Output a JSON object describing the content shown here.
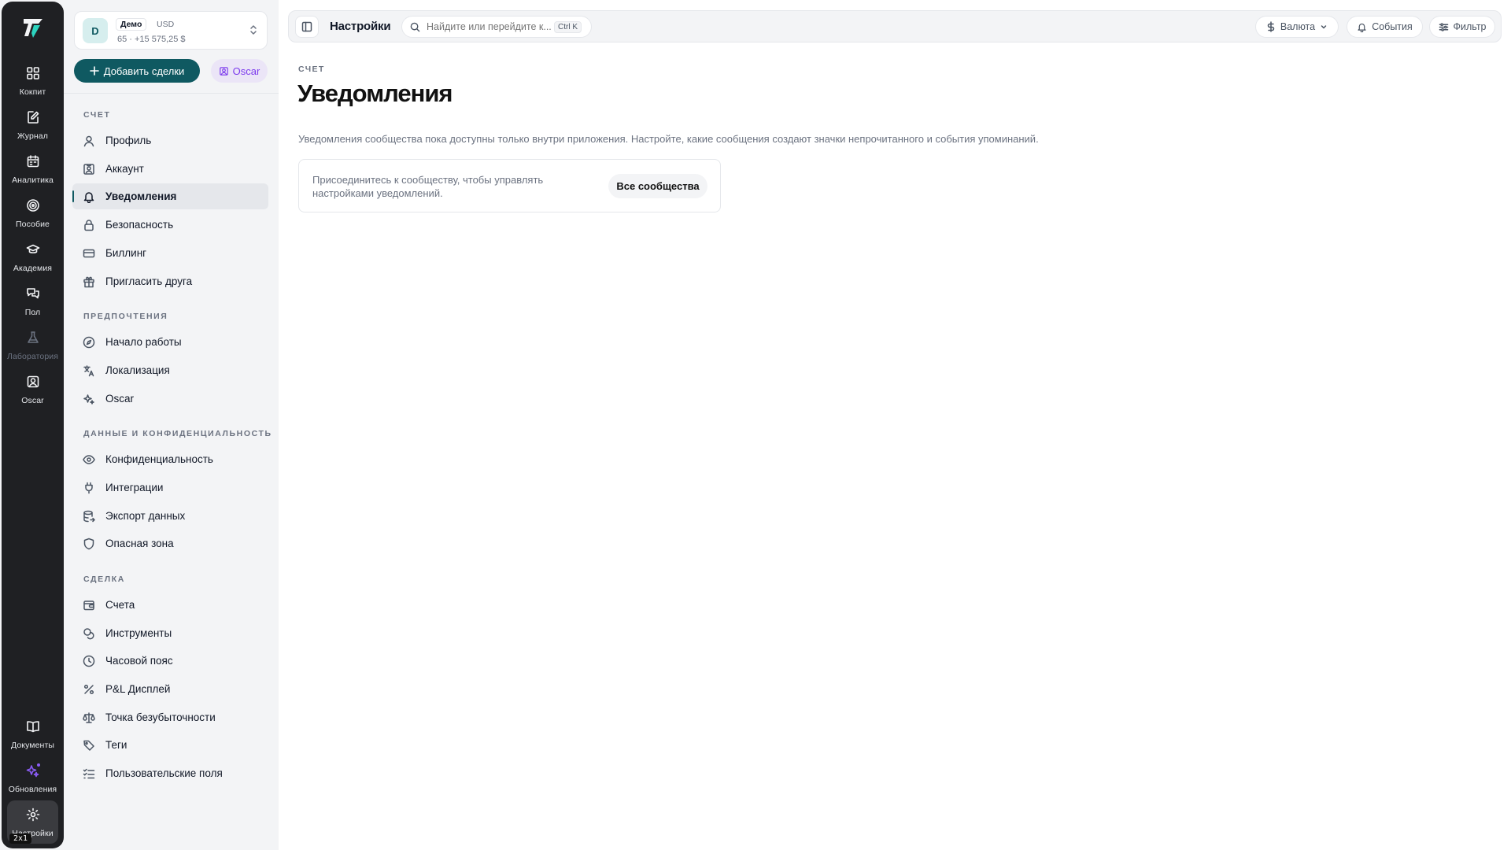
{
  "rail": {
    "items": [
      {
        "label": "Кокпит",
        "icon": "grid-icon"
      },
      {
        "label": "Журнал",
        "icon": "journal-icon"
      },
      {
        "label": "Аналитика",
        "icon": "calendar-icon"
      },
      {
        "label": "Пособие",
        "icon": "target-icon"
      },
      {
        "label": "Академия",
        "icon": "graduation-cap-icon"
      },
      {
        "label": "Пол",
        "icon": "chat-bubbles-icon"
      },
      {
        "label": "Лаборатория",
        "icon": "flask-icon"
      },
      {
        "label": "Oscar",
        "icon": "portrait-icon"
      }
    ],
    "bottom": [
      {
        "label": "Документы",
        "icon": "book-icon"
      },
      {
        "label": "Обновления",
        "icon": "sparkles-icon"
      },
      {
        "label": "Настройки",
        "icon": "gear-icon"
      }
    ],
    "badge": "2x1"
  },
  "account": {
    "avatar": "D",
    "mode": "Демо",
    "currency": "USD",
    "balance": "65 · +15 575,25 $"
  },
  "actions": {
    "add_trades": "Добавить сделки",
    "oscar": "Oscar"
  },
  "sidebar": {
    "sections": [
      {
        "title": "Счет",
        "items": [
          {
            "label": "Профиль",
            "icon": "user-icon"
          },
          {
            "label": "Аккаунт",
            "icon": "id-card-icon"
          },
          {
            "label": "Уведомления",
            "icon": "bell-icon"
          },
          {
            "label": "Безопасность",
            "icon": "lock-icon"
          },
          {
            "label": "Биллинг",
            "icon": "credit-card-icon"
          },
          {
            "label": "Пригласить друга",
            "icon": "gift-icon"
          }
        ]
      },
      {
        "title": "Предпочтения",
        "items": [
          {
            "label": "Начало работы",
            "icon": "compass-icon"
          },
          {
            "label": "Локализация",
            "icon": "translate-icon"
          },
          {
            "label": "Oscar",
            "icon": "sparkles-icon"
          }
        ]
      },
      {
        "title": "Данные и конфиденциальность",
        "items": [
          {
            "label": "Конфиденциальность",
            "icon": "eye-icon"
          },
          {
            "label": "Интеграции",
            "icon": "plug-icon"
          },
          {
            "label": "Экспорт данных",
            "icon": "database-export-icon"
          },
          {
            "label": "Опасная зона",
            "icon": "shield-icon"
          }
        ]
      },
      {
        "title": "Сделка",
        "items": [
          {
            "label": "Счета",
            "icon": "wallet-icon"
          },
          {
            "label": "Инструменты",
            "icon": "coins-icon"
          },
          {
            "label": "Часовой пояс",
            "icon": "clock-icon"
          },
          {
            "label": "P&L Дисплей",
            "icon": "percent-icon"
          },
          {
            "label": "Точка безубыточности",
            "icon": "scale-icon"
          },
          {
            "label": "Теги",
            "icon": "tag-icon"
          },
          {
            "label": "Пользовательские поля",
            "icon": "list-checks-icon"
          }
        ]
      }
    ]
  },
  "topbar": {
    "title": "Настройки",
    "search_placeholder": "Найдите или перейдите к...",
    "shortcut": "Ctrl K",
    "currency": "Валюта",
    "events": "События",
    "filter": "Фильтр"
  },
  "page": {
    "breadcrumb": "Счет",
    "title": "Уведомления",
    "description": "Уведомления сообщества пока доступны только внутри приложения. Настройте, какие сообщения создают значки непрочитанного и события упоминаний.",
    "card_text": "Присоединитесь к сообществу, чтобы управлять настройками уведомлений.",
    "card_button": "Все сообщества"
  },
  "colors": {
    "accent": "#0f5961",
    "oscar_purple": "#7c3aed",
    "rail_bg": "#1f2023"
  }
}
